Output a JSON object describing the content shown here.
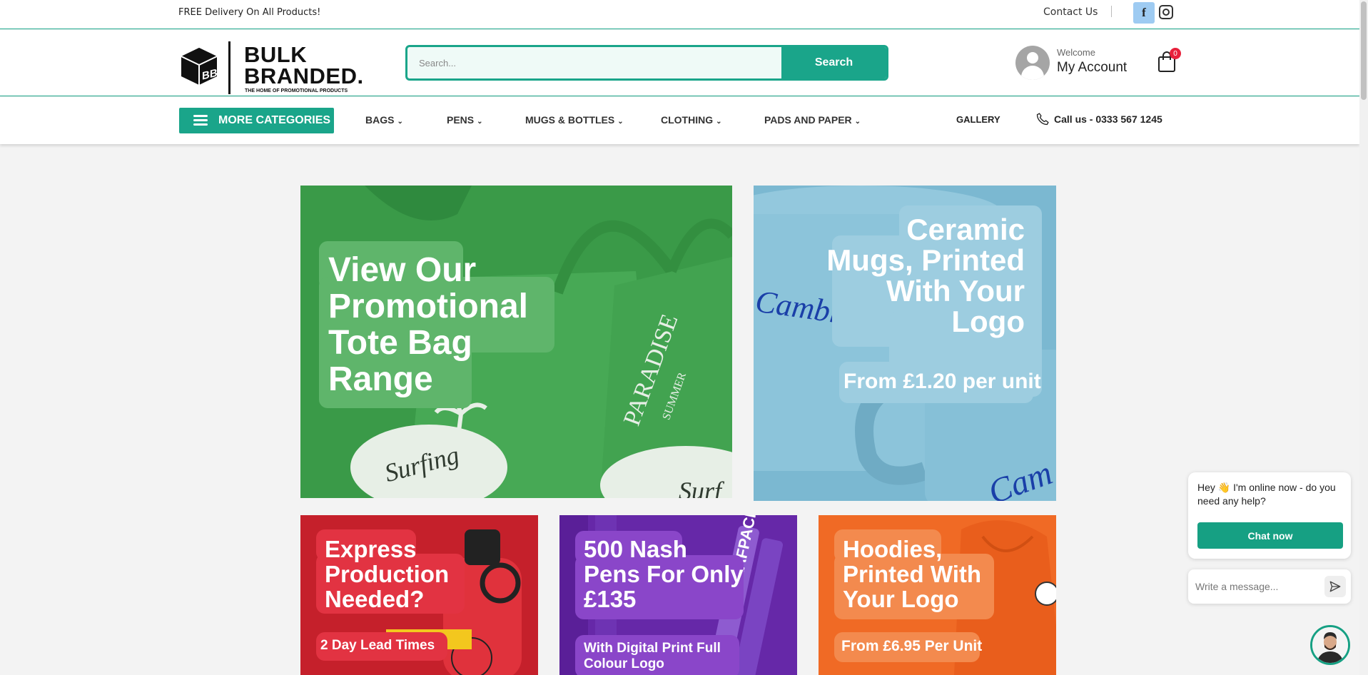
{
  "topbar": {
    "delivery": "FREE Delivery On All Products!",
    "contact": "Contact Us",
    "facebook_icon": "f"
  },
  "header": {
    "logo_line1": "BULK",
    "logo_line2": "BRANDED.",
    "logo_tagline": "THE HOME OF PROMOTIONAL PRODUCTS",
    "search_placeholder": "Search...",
    "search_button": "Search",
    "welcome": "Welcome",
    "account": "My Account",
    "cart_count": "0"
  },
  "nav": {
    "more_categories": "MORE CATEGORIES",
    "items": [
      {
        "label": "BAGS"
      },
      {
        "label": "PENS"
      },
      {
        "label": "MUGS & BOTTLES"
      },
      {
        "label": "CLOTHING"
      },
      {
        "label": "PADS AND PAPER"
      }
    ],
    "gallery": "GALLERY",
    "call": "Call us - 0333 567 1245"
  },
  "banners": {
    "tote": {
      "l1": "View Our",
      "l2": "Promotional",
      "l3": "Tote Bag",
      "l4": "Range"
    },
    "mugs": {
      "l1": "Ceramic",
      "l2": "Mugs, Printed",
      "l3": "With Your",
      "l4": "Logo",
      "price": "From £1.20 per unit",
      "brand": "Cambridge"
    },
    "express": {
      "l1": "Express",
      "l2": "Production",
      "l3": "Needed?",
      "sub": "2 Day Lead Times"
    },
    "pens": {
      "l1": "500 Nash",
      "l2": "Pens For Only",
      "l3": "£135",
      "sub1": "With Digital Print Full",
      "sub2": "Colour Logo"
    },
    "hoodies": {
      "l1": "Hoodies,",
      "l2": "Printed With",
      "l3": "Your Logo",
      "sub": "From £6.95 Per Unit"
    }
  },
  "chat": {
    "message": "Hey 👋 I'm online now - do you need any help?",
    "button": "Chat now",
    "input_placeholder": "Write a message..."
  },
  "colors": {
    "brand": "#1aa58a",
    "badge": "#e8213b"
  }
}
